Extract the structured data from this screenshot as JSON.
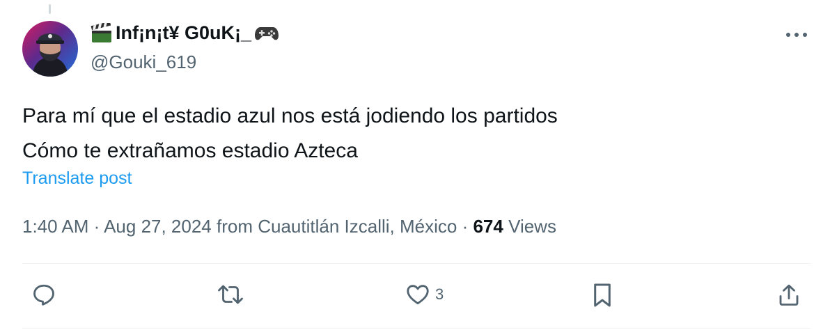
{
  "author": {
    "display_name": "Inf¡n¡t¥ G0uK¡_",
    "display_name_prefix_icon": "clapperboard-icon",
    "display_name_suffix_icon": "game-controller-icon",
    "handle": "@Gouki_619"
  },
  "post": {
    "text_line1": "Para mí que el estadio azul nos está jodiendo los partidos",
    "text_line2": "Cómo te extrañamos estadio Azteca",
    "translate_label": "Translate post"
  },
  "meta": {
    "time": "1:40 AM",
    "sep1": " · ",
    "date": "Aug 27, 2024",
    "location": " from Cuautitlán Izcalli, México",
    "sep2": " · ",
    "views_count": "674",
    "views_label": " Views"
  },
  "actions": {
    "reply_icon": "reply-icon",
    "repost_icon": "repost-icon",
    "like_icon": "heart-icon",
    "like_count": "3",
    "bookmark_icon": "bookmark-icon",
    "share_icon": "share-icon"
  },
  "more_icon": "more-icon",
  "colors": {
    "accent": "#1d9bf0",
    "text_primary": "#0f1419",
    "text_secondary": "#536471",
    "divider": "#eff3f4"
  }
}
